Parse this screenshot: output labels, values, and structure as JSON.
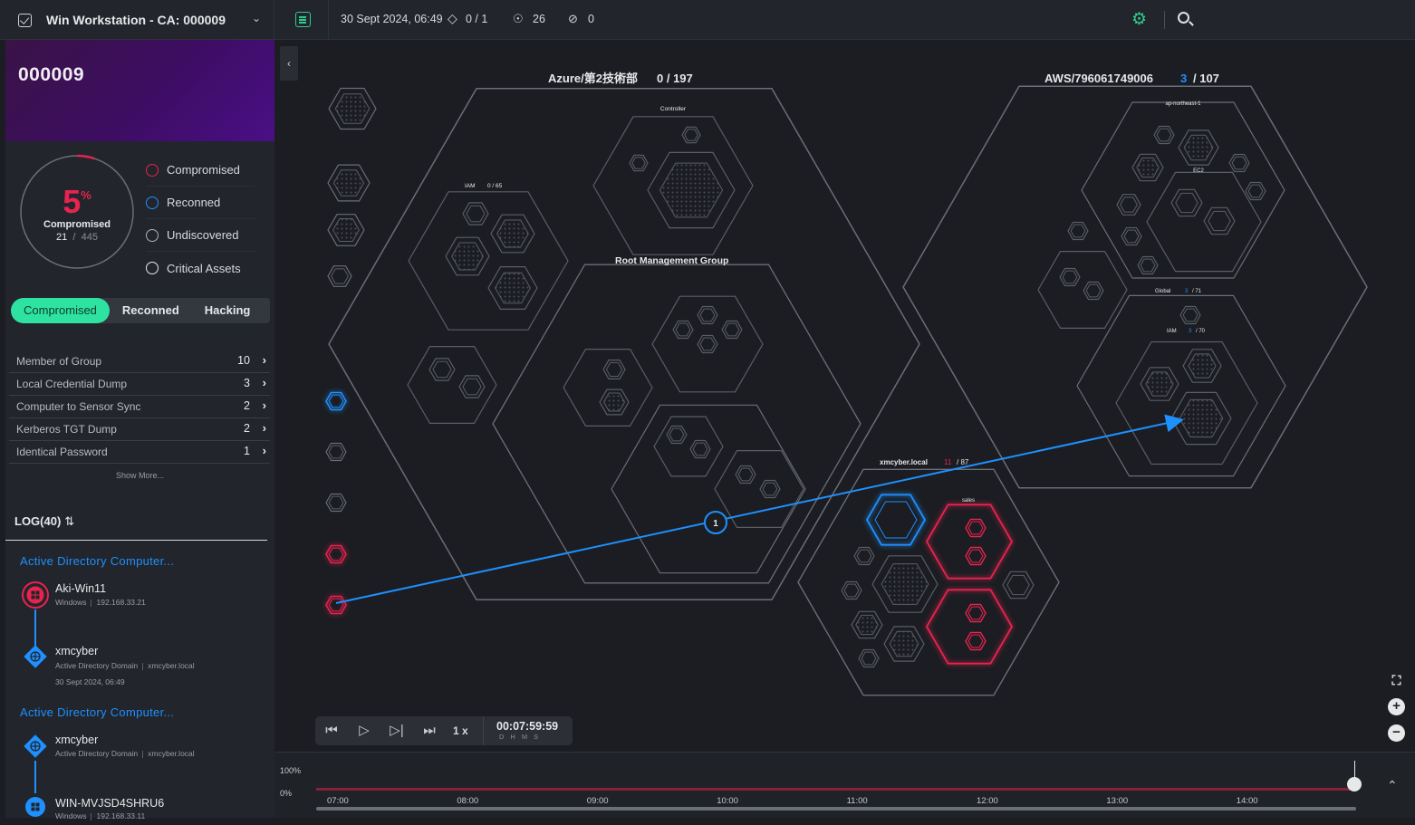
{
  "topbar": {
    "workstation_title": "Win Workstation - CA: 000009",
    "datetime": "30 Sept 2024, 06:49",
    "diamond_count": "0 / 1",
    "target_count": "26",
    "blocked_count": "0",
    "icons": [
      "checkbox-icon",
      "chevron-down-icon",
      "document-icon",
      "diamond-icon",
      "target-icon",
      "blocked-icon",
      "gear-icon",
      "search-icon"
    ]
  },
  "sidebar": {
    "scenario_id": "000009",
    "gauge": {
      "percent": "5",
      "percent_sign": "%",
      "label": "Compromised",
      "count": "21",
      "total": "445",
      "fraction": 0.05
    },
    "legend": [
      {
        "label": "Compromised",
        "color": "#e8234f"
      },
      {
        "label": "Reconned",
        "color": "#1e90ff"
      },
      {
        "label": "Undiscovered",
        "color": "#b0b3b8"
      },
      {
        "label": "Critical Assets",
        "color": "#e6e8ea"
      }
    ],
    "tabs": [
      "Compromised",
      "Reconned",
      "Hacking"
    ],
    "techniques": [
      {
        "name": "Member of Group",
        "count": "10"
      },
      {
        "name": "Local Credential Dump",
        "count": "3"
      },
      {
        "name": "Computer to Sensor Sync",
        "count": "2"
      },
      {
        "name": "Kerberos TGT Dump",
        "count": "2"
      },
      {
        "name": "Identical Password",
        "count": "1"
      }
    ],
    "show_more": "Show More...",
    "log_title": "LOG(40)",
    "log": [
      {
        "title": "Active Directory Computer...",
        "from": {
          "name": "Aki-Win11",
          "type": "Windows",
          "detail": "192.168.33.21",
          "icon": "windows-icon",
          "color": "#e8234f"
        },
        "to": {
          "name": "xmcyber",
          "type": "Active Directory Domain",
          "detail": "xmcyber.local",
          "time": "30 Sept 2024, 06:49",
          "icon": "domain-icon",
          "color": "#1e90ff"
        }
      },
      {
        "title": "Active Directory Computer...",
        "from": {
          "name": "xmcyber",
          "type": "Active Directory Domain",
          "detail": "xmcyber.local",
          "icon": "domain-icon",
          "color": "#1e90ff"
        },
        "to": {
          "name": "WIN-MVJSD4SHRU6",
          "type": "Windows",
          "detail": "192.168.33.11",
          "icon": "windows-icon",
          "color": "#1e90ff"
        }
      }
    ]
  },
  "map": {
    "azure_title": "Azure/第2技術部",
    "azure_count": "0 / 197",
    "controller_label": "Controller",
    "iam_label": "IAM",
    "iam_count": "0 / 65",
    "root_label": "Root Management Group",
    "aws_title": "AWS/796061749006",
    "aws_compromised": "3",
    "aws_total": "/ 107",
    "region_label": "ap-northeast-1",
    "ec2_label": "EC2",
    "global_label": "Global",
    "global_compromised": "3",
    "global_total": "/ 71",
    "aws_iam_label": "IAM",
    "aws_iam_compromised": "3",
    "aws_iam_total": "/ 70",
    "local_title": "xmcyber.local",
    "local_compromised": "11",
    "local_total": "/ 87",
    "sales_label": "sales",
    "path_step": "1"
  },
  "player": {
    "speed": "1 x",
    "elapsed": "00:07:59:59",
    "units": "DHMS"
  },
  "timeline": {
    "y_top": "100%",
    "y_bottom": "0%",
    "ticks": [
      "07:00",
      "08:00",
      "09:00",
      "10:00",
      "11:00",
      "12:00",
      "13:00",
      "14:00"
    ],
    "position": 1.0
  },
  "colors": {
    "accent": "#2ee3a1",
    "compromised": "#e8234f",
    "reconned": "#1e90ff",
    "purple": "#3d0d63"
  }
}
